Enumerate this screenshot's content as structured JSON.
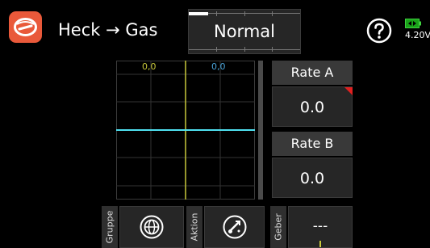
{
  "header": {
    "title": "Heck → Gas",
    "mode": "Normal",
    "battery_voltage": "4.20V",
    "app_icon": "helicopter-icon",
    "help_icon": "help-icon",
    "battery_icon": "battery-icon"
  },
  "graph": {
    "left_value": "0,0",
    "right_value": "0,0",
    "curve_level": 0.0
  },
  "rates": {
    "a": {
      "label": "Rate A",
      "value": "0.0"
    },
    "b": {
      "label": "Rate B",
      "value": "0.0"
    }
  },
  "bottom": {
    "group_label": "Gruppe",
    "action_label": "Aktion",
    "source_label": "Geber",
    "source_value": "---",
    "group_icon": "globe-icon",
    "action_icon": "switch-action-icon"
  },
  "colors": {
    "accent": "#e9593a",
    "curve": "#4fe0f0",
    "cursor": "#c8c83a",
    "right_value": "#4aa3d8",
    "marker": "#e02020"
  }
}
